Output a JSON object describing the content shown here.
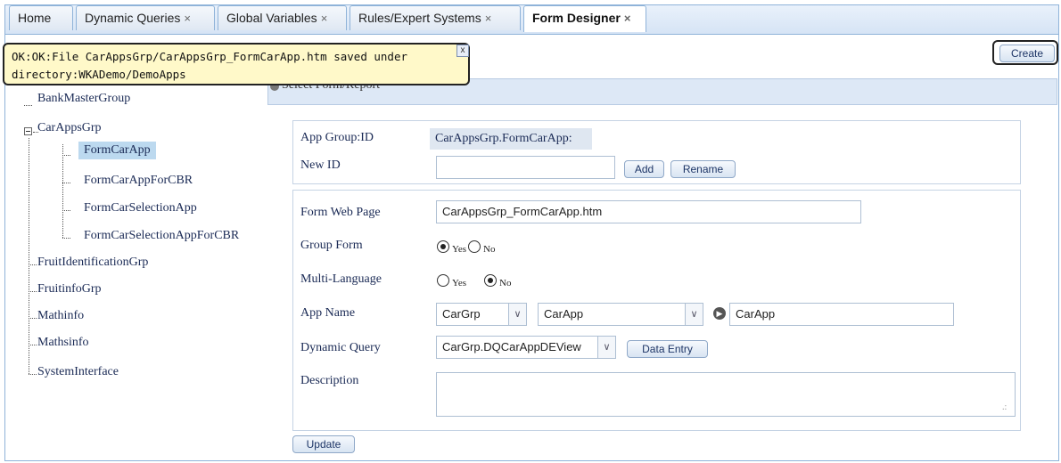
{
  "tabs": [
    {
      "label": "Home",
      "closable": false
    },
    {
      "label": "Dynamic Queries",
      "closable": true
    },
    {
      "label": "Global Variables",
      "closable": true
    },
    {
      "label": "Rules/Expert Systems",
      "closable": true
    },
    {
      "label": "Form Designer",
      "closable": true,
      "active": true
    }
  ],
  "close_glyph": "×",
  "toast": {
    "line1": "OK:OK:File CarAppsGrp/CarAppsGrp_FormCarApp.htm saved under",
    "line2": "directory:WKADemo/DemoApps",
    "close_label": "x"
  },
  "toolbar": {
    "create_label": "Create"
  },
  "select_header": {
    "label": "Select Form/Report"
  },
  "tree": {
    "items": [
      {
        "label": "BankMasterGroup"
      },
      {
        "label": "CarAppsGrp",
        "expanded": true,
        "children": [
          {
            "label": "FormCarApp",
            "selected": true
          },
          {
            "label": "FormCarAppForCBR"
          },
          {
            "label": "FormCarSelectionApp"
          },
          {
            "label": "FormCarSelectionAppForCBR"
          }
        ]
      },
      {
        "label": "FruitIdentificationGrp"
      },
      {
        "label": "FruitinfoGrp"
      },
      {
        "label": "Mathinfo"
      },
      {
        "label": "Mathsinfo"
      },
      {
        "label": "SystemInterface"
      }
    ]
  },
  "id_panel": {
    "app_group_label": "App Group:ID",
    "app_group_value": "CarAppsGrp.FormCarApp:",
    "new_id_label": "New ID",
    "new_id_value": "",
    "add_label": "Add",
    "rename_label": "Rename"
  },
  "form": {
    "web_page_label": "Form Web Page",
    "web_page_value": "CarAppsGrp_FormCarApp.htm",
    "group_form_label": "Group Form",
    "group_form_value": "Yes",
    "multi_language_label": "Multi-Language",
    "multi_language_value": "No",
    "yes_label": "Yes",
    "no_label": "No",
    "app_name_label": "App Name",
    "app_group_select": "CarGrp",
    "app_select": "CarApp",
    "app_name_value": "CarApp",
    "dynamic_query_label": "Dynamic Query",
    "dynamic_query_value": "CarGrp.DQCarAppDEView",
    "data_entry_label": "Data Entry",
    "description_label": "Description",
    "description_value": ""
  },
  "update_label": "Update",
  "colors": {
    "accent": "#8fb3d9",
    "selected_bg": "#bcd9ef",
    "toast_bg": "#fff9c9"
  }
}
